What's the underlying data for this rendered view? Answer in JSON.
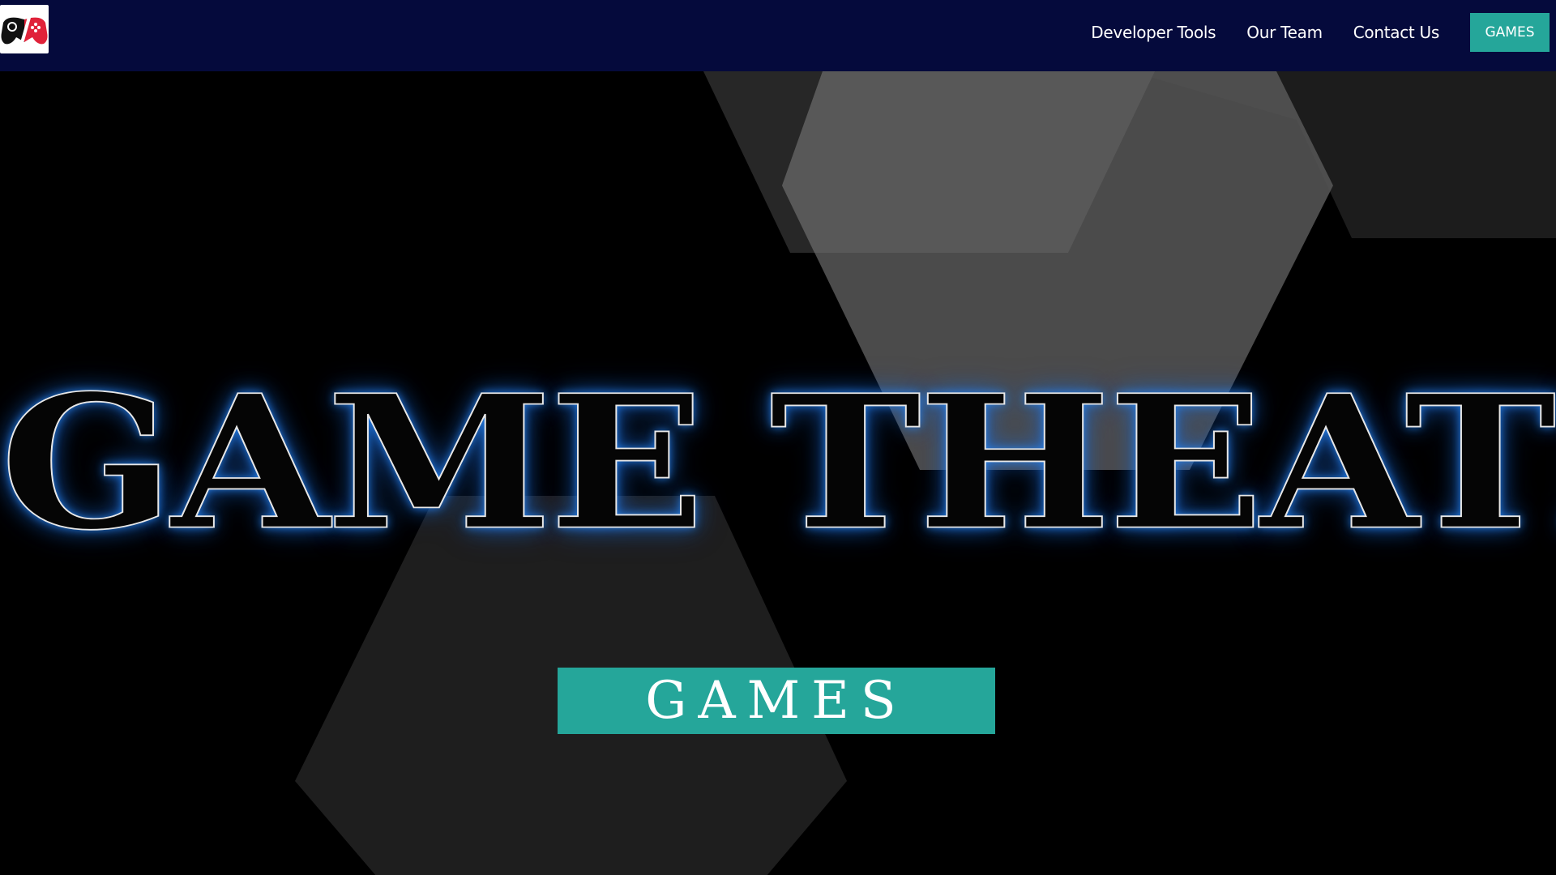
{
  "nav": {
    "logo_icon": "game-controller-icon",
    "links": [
      {
        "label": "Developer Tools"
      },
      {
        "label": "Our Team"
      },
      {
        "label": "Contact Us"
      }
    ],
    "cta_label": "GAMES"
  },
  "hero": {
    "title": "GAME THEATRE",
    "button_label": "GAMES"
  },
  "colors": {
    "nav_bg": "#050a3c",
    "accent": "#25a69a",
    "hero_bg": "#000000",
    "title_glow": "#1e6edc"
  }
}
